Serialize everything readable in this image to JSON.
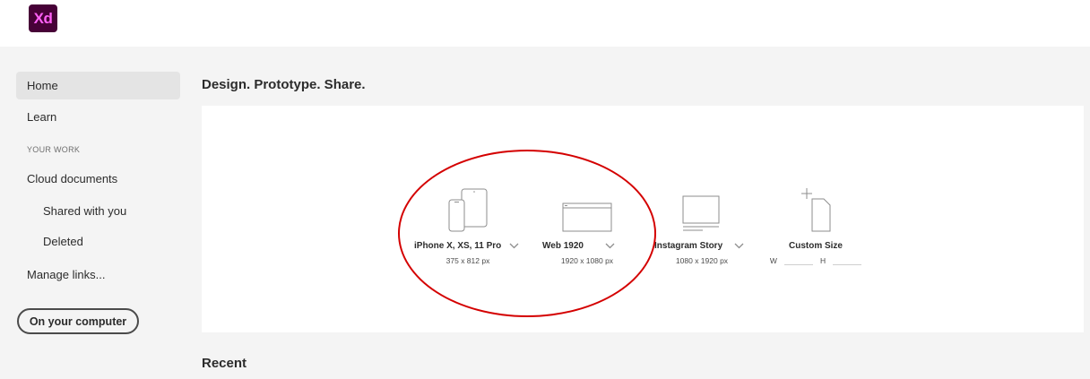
{
  "app": {
    "logo_text": "Xd"
  },
  "sidebar": {
    "items": [
      {
        "label": "Home",
        "active": true
      },
      {
        "label": "Learn"
      },
      {
        "section_label": "YOUR WORK"
      },
      {
        "label": "Cloud documents"
      },
      {
        "label": "Shared with you"
      },
      {
        "label": "Deleted"
      },
      {
        "label": "Manage links..."
      }
    ],
    "on_computer_button": "On your computer"
  },
  "main": {
    "heading": "Design. Prototype. Share.",
    "presets": [
      {
        "name": "iPhone X, XS, 11 Pro",
        "size": "375 x 812 px",
        "icon": "phone-tablet-icon"
      },
      {
        "name": "Web 1920",
        "size": "1920 x 1080 px",
        "icon": "web-browser-icon"
      },
      {
        "name": "Instagram Story",
        "size": "1080 x 1920 px",
        "icon": "instagram-story-icon"
      },
      {
        "name": "Custom Size",
        "w_label": "W",
        "h_label": "H",
        "icon": "custom-size-icon"
      }
    ],
    "recent_heading": "Recent"
  },
  "colors": {
    "brand_bg": "#470137",
    "brand_text": "#ff61f6",
    "annotation_circle": "#d40000"
  }
}
